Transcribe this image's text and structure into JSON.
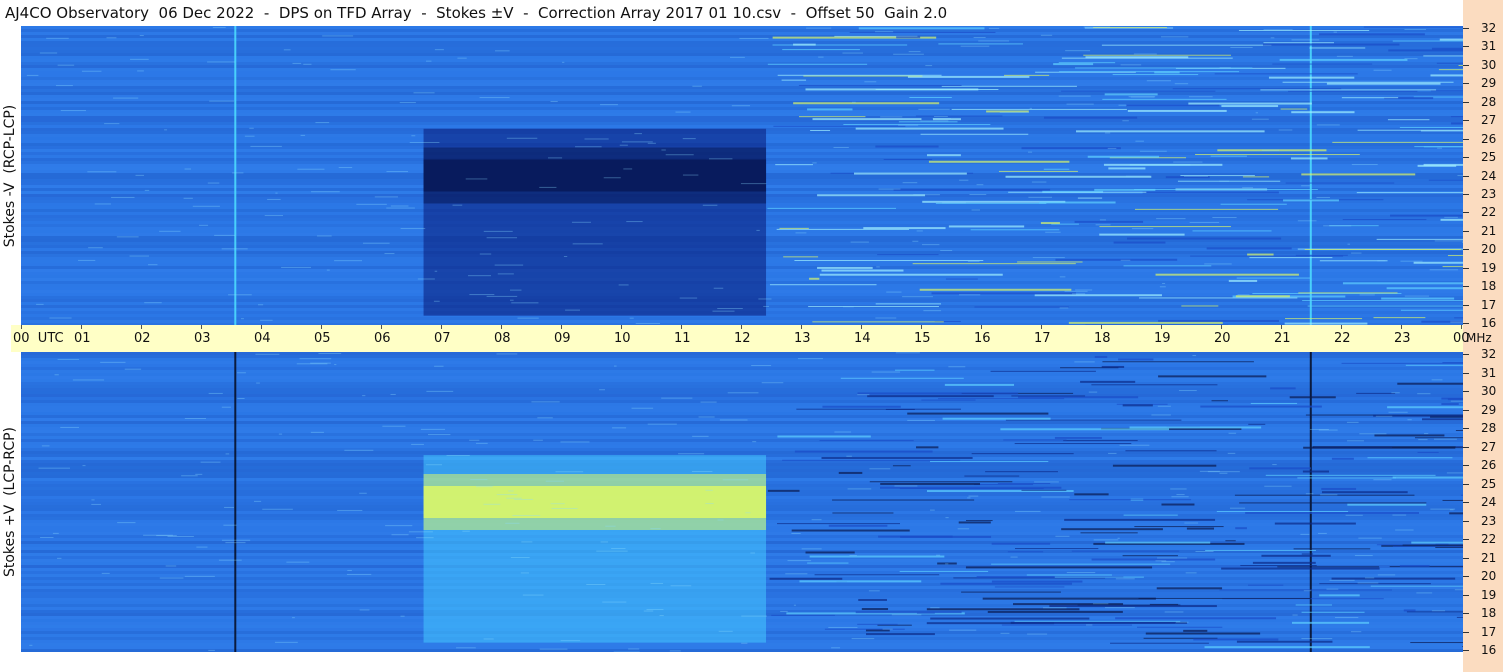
{
  "title": "AJ4CO Observatory  06 Dec 2022  -  DPS on TFD Array  -  Stokes ±V  -  Correction Array 2017 01 10.csv  -  Offset 50  Gain 2.0",
  "panels": [
    {
      "id": "minus-v",
      "label": "Stokes -V  (RCP-LCP)"
    },
    {
      "id": "plus-v",
      "label": "Stokes +V  (LCP-RCP)"
    }
  ],
  "time_axis": {
    "labels": [
      "00  UTC",
      "01",
      "02",
      "03",
      "04",
      "05",
      "06",
      "07",
      "08",
      "09",
      "10",
      "11",
      "12",
      "13",
      "14",
      "15",
      "16",
      "17",
      "18",
      "19",
      "20",
      "21",
      "22",
      "23",
      "00"
    ]
  },
  "freq_axis": {
    "unit": "MHz",
    "labels": [
      "32",
      "31",
      "30",
      "29",
      "28",
      "27",
      "26",
      "25",
      "24",
      "23",
      "22",
      "21",
      "20",
      "19",
      "18",
      "17",
      "16"
    ]
  },
  "colors": {
    "background_blue": "#2b77e6",
    "dark_blue": "#081a5a",
    "bright_cyan": "#4fe0ff",
    "yellow_green": "#d8f56a",
    "axis_band": "#ffffc6",
    "side_strip": "#fbdcc0"
  },
  "chart_data": [
    {
      "type": "heatmap",
      "panel": "Stokes -V  (RCP-LCP)",
      "x_label": "UTC",
      "y_label": "MHz",
      "xlim": [
        0,
        24
      ],
      "ylim": [
        16,
        32
      ],
      "features": [
        {
          "kind": "dark broadband patch",
          "t_start": 6.7,
          "t_end": 12.4,
          "f_start": 16.5,
          "f_end": 26.5,
          "peak_f": 24
        },
        {
          "kind": "narrow vertical line",
          "t": 3.55
        },
        {
          "kind": "narrow vertical line",
          "t": 21.45
        },
        {
          "kind": "noisy interference region",
          "t_start": 12.4,
          "t_end": 24
        }
      ]
    },
    {
      "type": "heatmap",
      "panel": "Stokes +V  (LCP-RCP)",
      "x_label": "UTC",
      "y_label": "MHz",
      "xlim": [
        0,
        24
      ],
      "ylim": [
        16,
        32
      ],
      "features": [
        {
          "kind": "bright broadband patch",
          "t_start": 6.7,
          "t_end": 12.4,
          "f_start": 16.5,
          "f_end": 26.5,
          "peak_f": 24
        },
        {
          "kind": "narrow vertical line",
          "t": 3.55
        },
        {
          "kind": "narrow vertical line",
          "t": 21.45
        },
        {
          "kind": "noisy interference region",
          "t_start": 12.4,
          "t_end": 24
        }
      ]
    }
  ]
}
